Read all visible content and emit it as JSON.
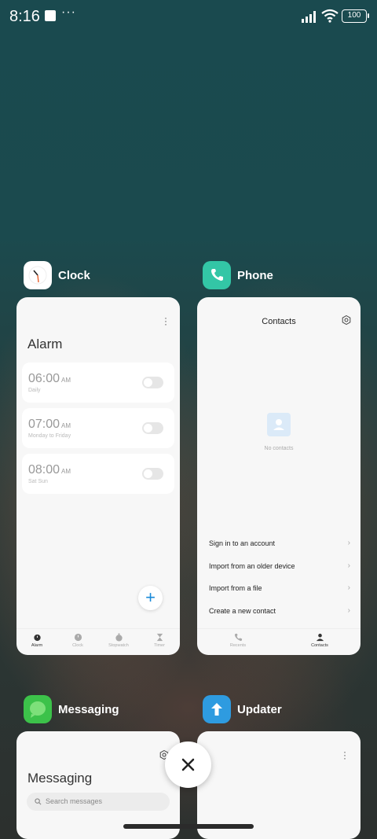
{
  "status": {
    "time": "8:16",
    "dots": "···",
    "battery": "100"
  },
  "apps": {
    "clock": {
      "label": "Clock",
      "screen": {
        "title": "Alarm",
        "alarms": [
          {
            "time": "06:00",
            "ampm": "AM",
            "sub": "Daily"
          },
          {
            "time": "07:00",
            "ampm": "AM",
            "sub": "Monday to Friday"
          },
          {
            "time": "08:00",
            "ampm": "AM",
            "sub": "Sat Sun"
          }
        ],
        "fab": "+",
        "nav": [
          "Alarm",
          "Clock",
          "Stopwatch",
          "Timer"
        ]
      }
    },
    "phone": {
      "label": "Phone",
      "screen": {
        "title": "Contacts",
        "empty": "No contacts",
        "menu": [
          "Sign in to an account",
          "Import from an older device",
          "Import from a file",
          "Create a new contact"
        ],
        "nav": [
          "Recents",
          "Contacts"
        ]
      }
    },
    "messaging": {
      "label": "Messaging",
      "screen": {
        "title": "Messaging",
        "search_placeholder": "Search messages"
      }
    },
    "updater": {
      "label": "Updater"
    }
  },
  "close_icon": "close-icon",
  "colors": {
    "accent": "#1a8ad8",
    "phone_icon": "#33c6a6",
    "messaging_icon": "#3cc24a",
    "updater_icon": "#2e9be0"
  }
}
